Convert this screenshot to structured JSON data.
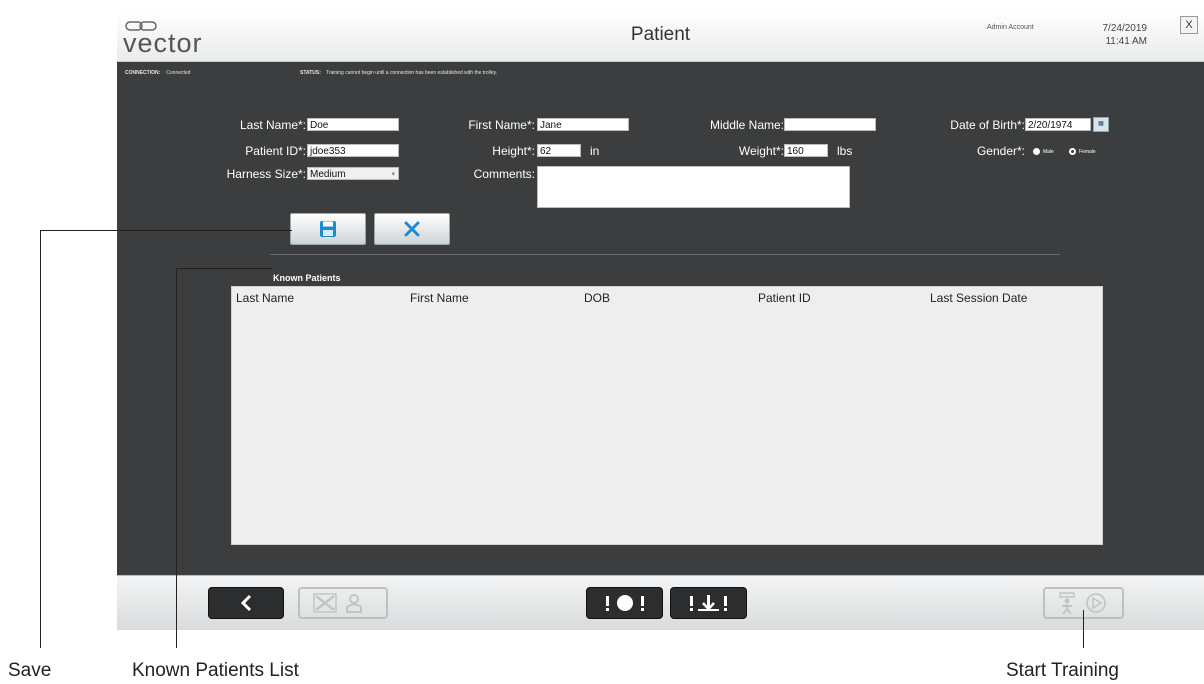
{
  "header": {
    "logo_text": "vector",
    "title": "Patient",
    "account": "Admin Account",
    "date": "7/24/2019",
    "time": "11:41 AM",
    "close_label": "X"
  },
  "status": {
    "connection_label": "CONNECTION:",
    "connection_value": "Connected",
    "status_label": "STATUS:",
    "status_value": "Training cannot begin until a connection has been established with the trolley."
  },
  "form": {
    "last_name": {
      "label": "Last Name*:",
      "value": "Doe"
    },
    "first_name": {
      "label": "First Name*:",
      "value": "Jane"
    },
    "middle_name": {
      "label": "Middle Name:",
      "value": ""
    },
    "dob": {
      "label": "Date of Birth*:",
      "value": "2/20/1974"
    },
    "patient_id": {
      "label": "Patient ID*:",
      "value": "jdoe353"
    },
    "height": {
      "label": "Height*:",
      "value": "62",
      "unit": "in"
    },
    "weight": {
      "label": "Weight*:",
      "value": "160",
      "unit": "lbs"
    },
    "gender": {
      "label": "Gender*:",
      "options": [
        "Male",
        "Female"
      ],
      "selected": "Female"
    },
    "harness_size": {
      "label": "Harness Size*:",
      "value": "Medium"
    },
    "comments": {
      "label": "Comments:",
      "value": ""
    }
  },
  "known_patients": {
    "title": "Known Patients",
    "columns": [
      "Last Name",
      "First Name",
      "DOB",
      "Patient ID",
      "Last Session Date"
    ],
    "rows": []
  },
  "icons": {
    "save": "floppy-disk-icon",
    "cancel": "x-icon",
    "back": "chevron-left-icon",
    "delete_patient": "delete-user-icon",
    "emergency_stop": "stop-icon",
    "calibrate": "weight-icon",
    "start_training": "start-training-icon",
    "calendar": "calendar-icon"
  },
  "colors": {
    "panel_bg": "#3b3d3e",
    "accent": "#1f8ad2"
  },
  "callouts": {
    "save": "Save",
    "known_patients_list": "Known Patients List",
    "start_training": "Start Training"
  }
}
